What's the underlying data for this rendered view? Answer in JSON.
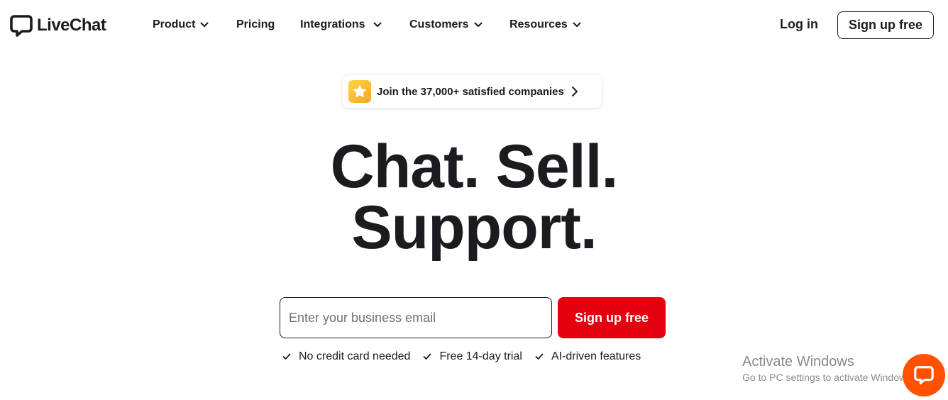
{
  "header": {
    "logo_text": "LiveChat",
    "nav": [
      {
        "label": "Product"
      },
      {
        "label": "Pricing"
      },
      {
        "label": "Integrations"
      },
      {
        "label": "Customers"
      },
      {
        "label": "Resources"
      }
    ],
    "login_label": "Log in",
    "signup_label": "Sign up free"
  },
  "badge": {
    "icon": "star-icon",
    "text": "Join the 37,000+ satisfied companies"
  },
  "hero": {
    "line1": "Chat. Sell.",
    "line2": "Support."
  },
  "signup_form": {
    "email_placeholder": "Enter your business email",
    "email_value": "",
    "submit_label": "Sign up free"
  },
  "benefits": [
    "No credit card needed",
    "Free 14-day trial",
    "AI-driven features"
  ],
  "watermark": {
    "title": "Activate Windows",
    "subtitle": "Go to PC settings to activate Windows."
  },
  "colors": {
    "text": "#1b1b20",
    "primary_button": "#e4000f",
    "chat_launcher": "#ff5100",
    "star_badge": "#f6a623"
  }
}
